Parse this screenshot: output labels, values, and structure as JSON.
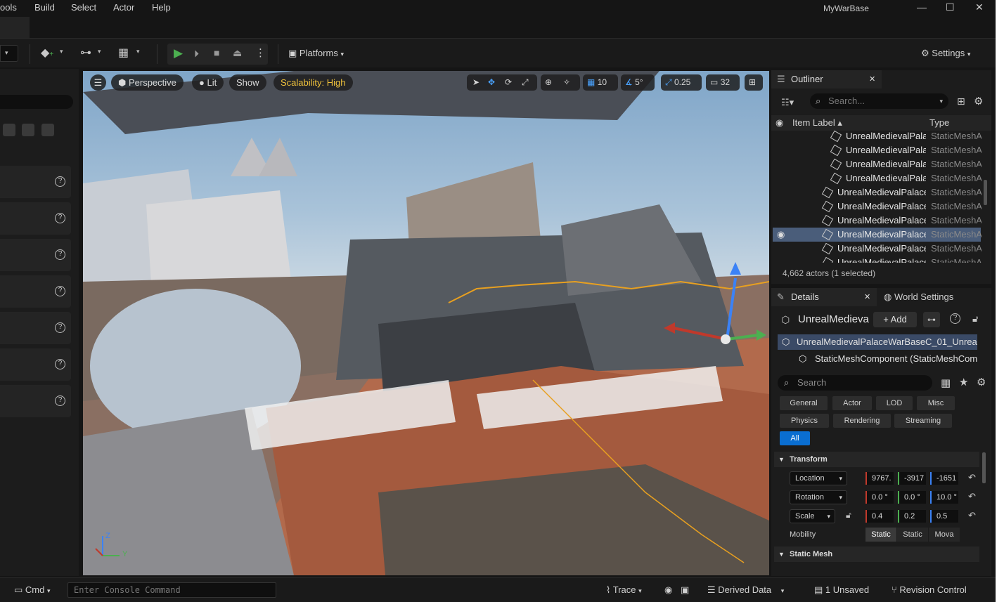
{
  "menu": [
    "ools",
    "Build",
    "Select",
    "Actor",
    "Help"
  ],
  "window": {
    "title": "MyWarBase",
    "minimize": "—",
    "maximize": "☐",
    "close": "✕"
  },
  "toolbar": {
    "platforms": "Platforms",
    "settings": "Settings"
  },
  "viewport": {
    "perspective": "Perspective",
    "lit": "Lit",
    "show": "Show",
    "scalability": "Scalability: High",
    "grid_snap": "10",
    "rotate_snap": "5°",
    "scale_snap": "0.25",
    "camera_speed": "32"
  },
  "outliner": {
    "title": "Outliner",
    "search_placeholder": "Search...",
    "col_label": "Item Label ▴",
    "col_type": "Type",
    "rows": [
      {
        "label": "UnrealMedievalPala",
        "type": "StaticMeshA",
        "indent": true
      },
      {
        "label": "UnrealMedievalPala",
        "type": "StaticMeshA",
        "indent": true
      },
      {
        "label": "UnrealMedievalPala",
        "type": "StaticMeshA",
        "indent": true
      },
      {
        "label": "UnrealMedievalPala",
        "type": "StaticMeshA",
        "indent": true
      },
      {
        "label": "UnrealMedievalPalace",
        "type": "StaticMeshA",
        "indent": false
      },
      {
        "label": "UnrealMedievalPalace",
        "type": "StaticMeshA",
        "indent": false
      },
      {
        "label": "UnrealMedievalPalace",
        "type": "StaticMeshA",
        "indent": false
      },
      {
        "label": "UnrealMedievalPalace",
        "type": "StaticMeshA",
        "indent": false,
        "selected": true
      },
      {
        "label": "UnrealMedievalPalace",
        "type": "StaticMeshA",
        "indent": false
      },
      {
        "label": "UnrealMedievalPalace",
        "type": "StaticMeshA",
        "indent": false
      }
    ],
    "count": "4,662 actors (1 selected)"
  },
  "details": {
    "tab": "Details",
    "world_tab": "World Settings",
    "actor_name": "UnrealMedieva",
    "add": "+ Add",
    "component_root": "UnrealMedievalPalaceWarBaseC_01_Unreal",
    "component_child": "StaticMeshComponent (StaticMeshCom",
    "search_placeholder": "Search",
    "filters": [
      "General",
      "Actor",
      "LOD",
      "Misc",
      "Physics",
      "Rendering",
      "Streaming",
      "All"
    ],
    "transform": "Transform",
    "location": {
      "label": "Location",
      "x": "9767.",
      "y": "-3917",
      "z": "-1651"
    },
    "rotation": {
      "label": "Rotation",
      "x": "0.0 °",
      "y": "0.0 °",
      "z": "10.0 °"
    },
    "scale": {
      "label": "Scale",
      "x": "0.4",
      "y": "0.2",
      "z": "0.5"
    },
    "mobility": {
      "label": "Mobility",
      "options": [
        "Static",
        "Static",
        "Mova"
      ]
    },
    "static_mesh": "Static Mesh"
  },
  "status": {
    "cmd": "Cmd",
    "console_placeholder": "Enter Console Command",
    "trace": "Trace",
    "derived": "Derived Data",
    "unsaved": "1 Unsaved",
    "revision": "Revision Control"
  },
  "colors": {
    "accent": "#0a6ed1",
    "scalability": "#f0c23c",
    "selected_row": "#4a5d7a",
    "x_axis": "#c0392b",
    "y_axis": "#4caf50",
    "z_axis": "#3b82f6"
  }
}
